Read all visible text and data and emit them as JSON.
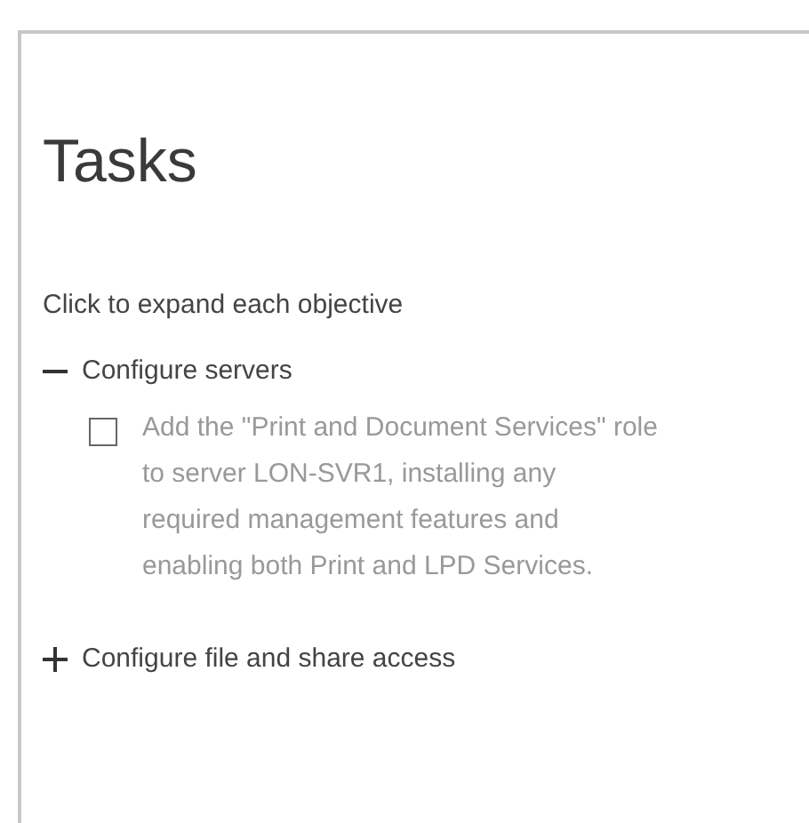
{
  "panel": {
    "title": "Tasks",
    "instruction": "Click to expand each objective",
    "objectives": [
      {
        "label": "Configure servers",
        "expanded": true,
        "tasks": [
          {
            "text": "Add the \"Print and Document Services\" role to server LON-SVR1, installing any required management features and enabling both Print and LPD Services.",
            "checked": false
          }
        ]
      },
      {
        "label": "Configure file and share access",
        "expanded": false
      }
    ]
  }
}
